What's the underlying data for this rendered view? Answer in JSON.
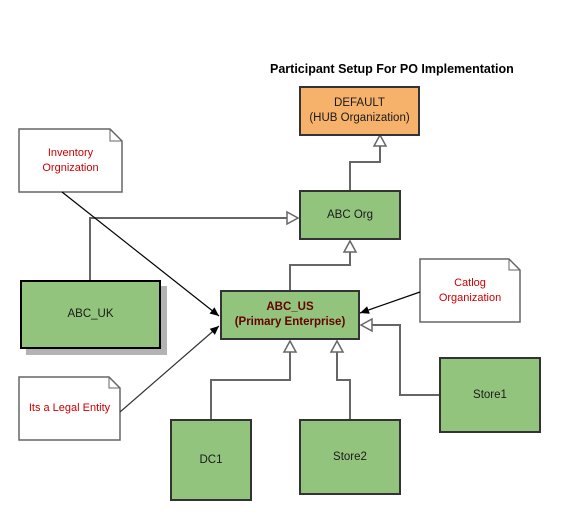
{
  "diagram": {
    "title": "Participant Setup For PO Implementation",
    "nodes": {
      "default": {
        "line1": "DEFAULT",
        "line2": "(HUB Organization)",
        "fill": "#f6b26b"
      },
      "abc_org": {
        "label": "ABC Org",
        "fill": "#93c47d"
      },
      "abc_us": {
        "line1": "ABC_US",
        "line2": "(Primary Enterprise)",
        "fill": "#93c47d",
        "text_color": "#660000"
      },
      "abc_uk": {
        "label": "ABC_UK",
        "fill": "#93c47d"
      },
      "dc1": {
        "label": "DC1",
        "fill": "#93c47d"
      },
      "store2": {
        "label": "Store2",
        "fill": "#93c47d"
      },
      "store1": {
        "label": "Store1",
        "fill": "#93c47d"
      }
    },
    "notes": {
      "inventory": {
        "line1": "Inventory",
        "line2": "Orgnization"
      },
      "catlog": {
        "line1": "Catlog",
        "line2": "Organization"
      },
      "legal": {
        "label": "Its a Legal Entity"
      }
    },
    "note_text_color": "#cc0000",
    "edges": [
      {
        "from": "abc_org",
        "to": "default",
        "type": "generalization"
      },
      {
        "from": "abc_uk",
        "to": "abc_org",
        "type": "generalization"
      },
      {
        "from": "abc_us",
        "to": "abc_org",
        "type": "generalization"
      },
      {
        "from": "dc1",
        "to": "abc_us",
        "type": "generalization"
      },
      {
        "from": "store2",
        "to": "abc_us",
        "type": "generalization"
      },
      {
        "from": "store1",
        "to": "abc_us",
        "type": "generalization"
      },
      {
        "from": "inventory",
        "to": "abc_us",
        "type": "association"
      },
      {
        "from": "legal",
        "to": "abc_us",
        "type": "association"
      },
      {
        "from": "catlog",
        "to": "abc_us",
        "type": "association"
      }
    ]
  }
}
